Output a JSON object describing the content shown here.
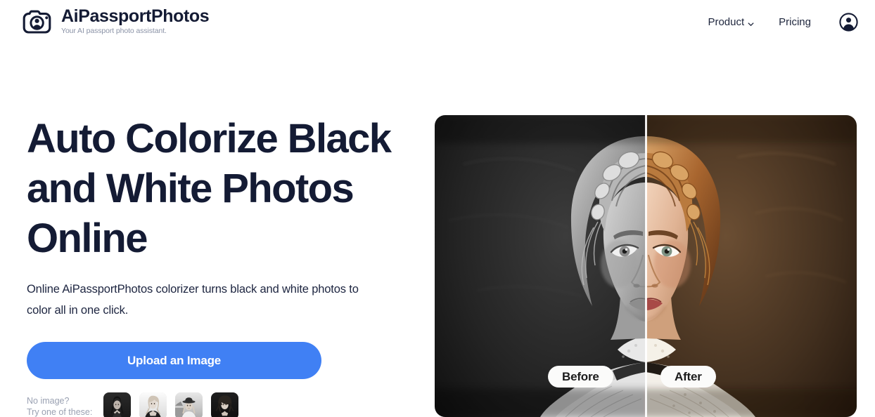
{
  "header": {
    "brand": {
      "name": "AiPassportPhotos",
      "tagline": "Your AI passport photo assistant.",
      "logo_icon": "camera-portrait-icon"
    },
    "nav": {
      "product_label": "Product",
      "product_chevron_icon": "chevron-down-icon",
      "pricing_label": "Pricing",
      "account_icon": "account-avatar-icon"
    }
  },
  "hero": {
    "title": "Auto Colorize Black and White Photos Online",
    "subtitle": "Online AiPassportPhotos colorizer turns black and white photos to color all in one click.",
    "cta_label": "Upload an Image",
    "samples": {
      "prompt_line1": "No image?",
      "prompt_line2": "Try one of these:",
      "thumbs": [
        {
          "name": "sample-thumb-1",
          "alt": "Woman in black dress on dark background"
        },
        {
          "name": "sample-thumb-2",
          "alt": "Blonde woman on light background"
        },
        {
          "name": "sample-thumb-3",
          "alt": "Woman wearing a hat outdoors"
        },
        {
          "name": "sample-thumb-4",
          "alt": "Curly haired woman on dark background"
        }
      ]
    },
    "comparison": {
      "before_label": "Before",
      "after_label": "After",
      "alt": "Portrait of a woman with braided updo, left half black and white, right half colorized"
    }
  },
  "colors": {
    "accent_blue": "#4080f4",
    "ink": "#141b34",
    "muted": "#9aa1b2",
    "page_bg": "#ffffff",
    "badge_bg": "#fbfbfa"
  }
}
